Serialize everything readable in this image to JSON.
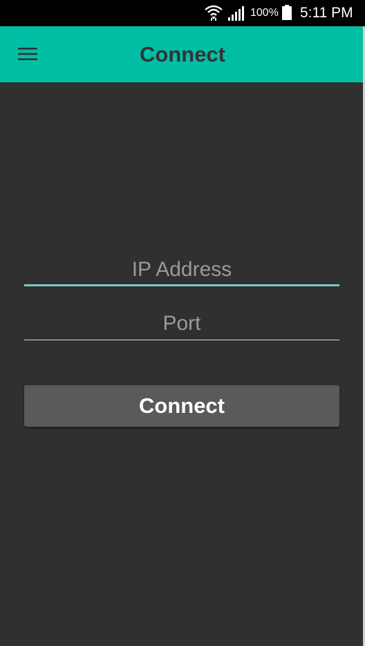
{
  "status_bar": {
    "battery_percent": "100%",
    "time": "5:11 PM",
    "icons": [
      "wifi-icon",
      "signal-icon",
      "battery-icon"
    ]
  },
  "app_bar": {
    "title": "Connect",
    "menu_icon": "hamburger-menu-icon",
    "background_color": "#00bfa5"
  },
  "form": {
    "ip_address": {
      "value": "",
      "placeholder": "IP Address"
    },
    "port": {
      "value": "",
      "placeholder": "Port"
    },
    "connect_label": "Connect"
  },
  "colors": {
    "background": "#303030",
    "accent": "#80cbc4",
    "button": "#5a5a5b"
  }
}
